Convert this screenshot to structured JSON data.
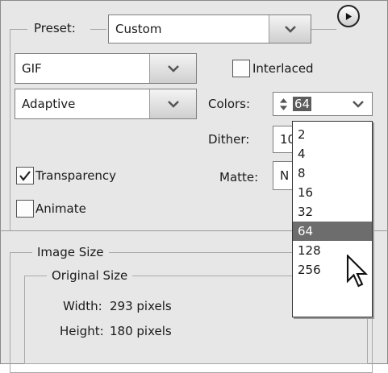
{
  "preset": {
    "label": "Preset:",
    "value": "Custom"
  },
  "format": {
    "value": "GIF"
  },
  "reduction": {
    "value": "Adaptive"
  },
  "interlaced": {
    "label": "Interlaced",
    "checked": false
  },
  "colors": {
    "label": "Colors:",
    "value": "64"
  },
  "dither": {
    "label": "Dither:",
    "value": "10"
  },
  "matte": {
    "label": "Matte:",
    "value": "N"
  },
  "transparency": {
    "label": "Transparency",
    "checked": true
  },
  "animate": {
    "label": "Animate",
    "checked": false
  },
  "colors_dropdown": {
    "options": [
      "2",
      "4",
      "8",
      "16",
      "32",
      "64",
      "128",
      "256"
    ],
    "selected": "64"
  },
  "image_size": {
    "title": "Image Size",
    "original_title": "Original Size",
    "width_label": "Width:",
    "width_value": "293 pixels",
    "height_label": "Height:",
    "height_value": "180 pixels"
  },
  "icons": {
    "optimize_menu": "play-circle-icon",
    "dropdown": "chevron-down-icon",
    "spinner": "up-down-arrows-icon",
    "check": "checkmark-icon",
    "cursor": "mouse-pointer-icon"
  },
  "colors_theme": {
    "panel": "#e7e7e7",
    "selection": "#6d6d6d"
  }
}
